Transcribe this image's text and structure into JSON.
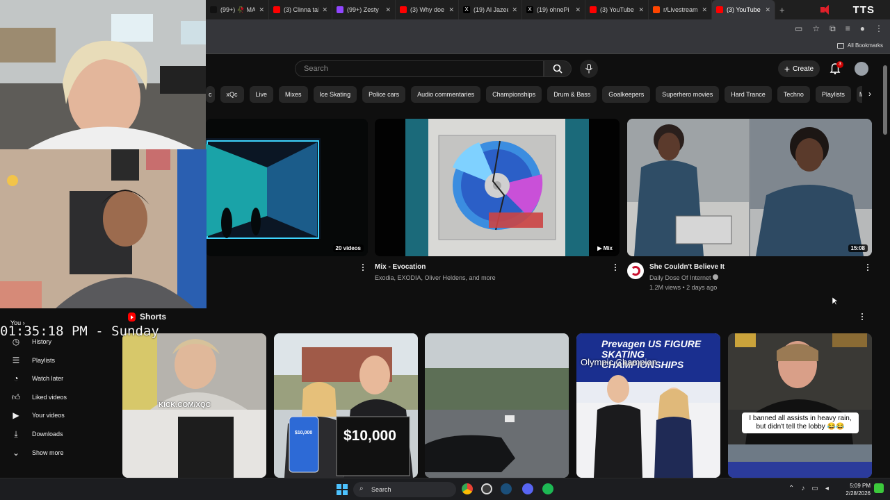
{
  "browser": {
    "tabs": [
      {
        "title": "(99+) 🥀 MA",
        "icon": "tiktok-icon",
        "color": "#111111",
        "active": false
      },
      {
        "title": "(3) Clinna tal",
        "icon": "youtube-icon",
        "color": "#ff0000",
        "active": false
      },
      {
        "title": "(99+) Zesty",
        "icon": "twitch-icon",
        "color": "#9146ff",
        "active": false
      },
      {
        "title": "(3) Why doe",
        "icon": "youtube-icon",
        "color": "#ff0000",
        "active": false
      },
      {
        "title": "(19) Al Jazee",
        "icon": "x-icon",
        "color": "#000000",
        "active": false
      },
      {
        "title": "(19) ohnePi",
        "icon": "x-icon",
        "color": "#000000",
        "active": false
      },
      {
        "title": "(3) YouTube",
        "icon": "youtube-icon",
        "color": "#ff0000",
        "active": false
      },
      {
        "title": "r/Livestream",
        "icon": "reddit-icon",
        "color": "#ff4500",
        "active": false
      },
      {
        "title": "(3) YouTube",
        "icon": "youtube-icon",
        "color": "#ff0000",
        "active": true
      }
    ],
    "new_tab": "+",
    "tts_label": "TTS",
    "bookmarks_label": "All Bookmarks"
  },
  "header": {
    "search_placeholder": "Search",
    "create_label": "Create",
    "notif_count": "3"
  },
  "chips": [
    "c",
    "xQc",
    "Live",
    "Mixes",
    "Ice Skating",
    "Police cars",
    "Audio commentaries",
    "Championships",
    "Drum & Bass",
    "Goalkeepers",
    "Superhero movies",
    "Hard Trance",
    "Techno",
    "Playlists",
    "M"
  ],
  "videos": [
    {
      "badge": "20 videos",
      "title": "",
      "meta1": "",
      "meta2": ""
    },
    {
      "badge": "Mix",
      "title": "Mix - Evocation",
      "meta1": "Exodia, EXODIA, Oliver Heldens, and more",
      "meta2": ""
    },
    {
      "badge": "15:08",
      "title": "She Couldn't Believe It",
      "meta1": "Daily Dose Of Internet",
      "meta2": "1.2M views • 2 days ago"
    }
  ],
  "shorts": {
    "title": "Shorts",
    "items": [
      {
        "overlay": "KICK.COM/XQC"
      },
      {
        "overlay": "$10,000",
        "phone": "$10,000"
      },
      {
        "overlay": ""
      },
      {
        "overlay": "Olympic Champion",
        "sign": "Prevagen US FIGURE SKATING CHAMPIONSHIPS"
      },
      {
        "overlay": "I banned all assists in heavy rain, but didn't tell the lobby 😂😂"
      }
    ]
  },
  "sidebar": {
    "you_label": "You",
    "items": [
      {
        "label": "History",
        "icon": "history-icon"
      },
      {
        "label": "Playlists",
        "icon": "playlists-icon"
      },
      {
        "label": "Watch later",
        "icon": "watch-later-icon"
      },
      {
        "label": "Liked videos",
        "icon": "like-icon"
      },
      {
        "label": "Your videos",
        "icon": "your-videos-icon"
      },
      {
        "label": "Downloads",
        "icon": "download-icon"
      },
      {
        "label": "Show more",
        "icon": "chevron-down-icon"
      }
    ]
  },
  "overlay_clock": "01:35:18 PM - Sunday",
  "taskbar": {
    "search_label": "Search",
    "time": "5:09 PM",
    "date": "2/28/2026"
  }
}
